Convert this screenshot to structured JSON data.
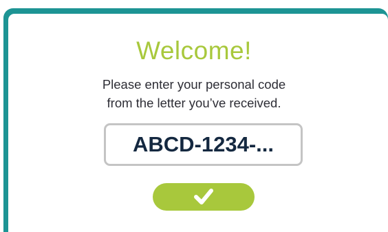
{
  "welcome": {
    "title": "Welcome!",
    "instruction_line1": "Please enter your personal code",
    "instruction_line2": "from the letter you’ve received."
  },
  "code_input": {
    "placeholder": "ABCD-1234-..."
  },
  "confirm_button": {
    "icon": "checkmark-icon"
  },
  "colors": {
    "frame": "#1d9494",
    "accent": "#a8c83c",
    "text": "#2d2d35",
    "code_text": "#142840",
    "input_border": "#c4c4c4"
  }
}
